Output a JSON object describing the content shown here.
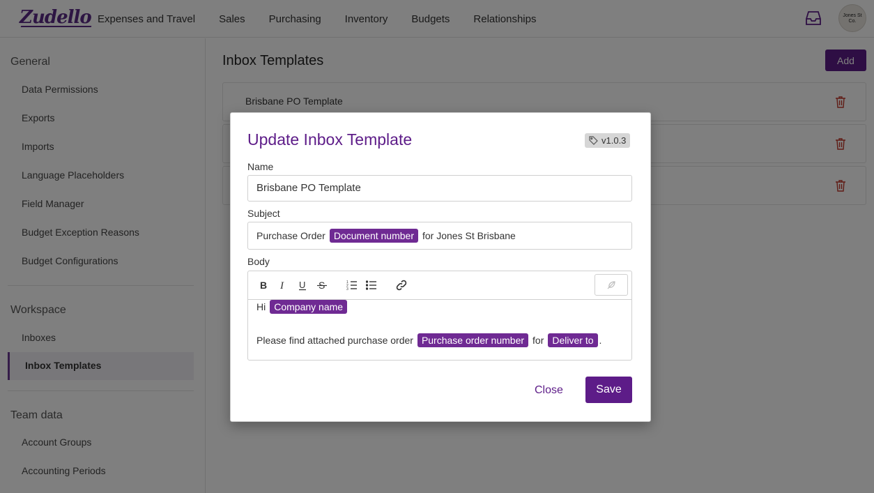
{
  "app": {
    "logo": "Zudello"
  },
  "nav": [
    "Expenses and Travel",
    "Sales",
    "Purchasing",
    "Inventory",
    "Budgets",
    "Relationships"
  ],
  "user": {
    "avatar_text_1": "Jones St",
    "avatar_text_2": "Co."
  },
  "sidebar": {
    "general_title": "General",
    "general_items": [
      "Data Permissions",
      "Exports",
      "Imports",
      "Language Placeholders",
      "Field Manager",
      "Budget Exception Reasons",
      "Budget Configurations"
    ],
    "workspace_title": "Workspace",
    "workspace_items": [
      "Inboxes",
      "Inbox Templates"
    ],
    "team_title": "Team data",
    "team_items": [
      "Account Groups",
      "Accounting Periods"
    ]
  },
  "main": {
    "title": "Inbox Templates",
    "add_label": "Add",
    "templates": [
      "Brisbane PO Template",
      "",
      ""
    ]
  },
  "modal": {
    "title": "Update Inbox Template",
    "version": "v1.0.3",
    "name_label": "Name",
    "name_value": "Brisbane PO Template",
    "subject_label": "Subject",
    "subject_prefix": "Purchase Order",
    "subject_chip": "Document number",
    "subject_suffix": "for Jones St Brisbane",
    "body_label": "Body",
    "body_line1_prefix": "Hi",
    "body_line1_chip": "Company name",
    "body_line2_prefix": "Please find attached purchase order",
    "body_line2_chip1": "Purchase order number",
    "body_line2_mid": "for",
    "body_line2_chip2": "Deliver to",
    "body_line2_end": ".",
    "close_label": "Close",
    "save_label": "Save"
  },
  "colors": {
    "brand": "#5d1c88",
    "chip": "#6f2a93"
  }
}
